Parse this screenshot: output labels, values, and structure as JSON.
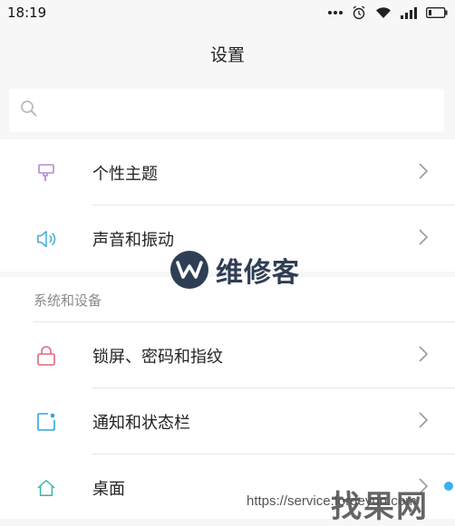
{
  "status_bar": {
    "time": "18:19",
    "icons": [
      "more-dots-icon",
      "alarm-icon",
      "wifi-icon",
      "signal-icon",
      "battery-icon"
    ]
  },
  "header": {
    "title": "设置"
  },
  "search": {
    "placeholder": "",
    "icon": "search-icon"
  },
  "group1": {
    "items": [
      {
        "label": "个性主题",
        "icon": "theme-brush-icon",
        "color": "#b589d6"
      },
      {
        "label": "声音和振动",
        "icon": "speaker-icon",
        "color": "#3fa9d8"
      }
    ]
  },
  "group2": {
    "section_title": "系统和设备",
    "items": [
      {
        "label": "锁屏、密码和指纹",
        "icon": "lock-icon",
        "color": "#e0697a"
      },
      {
        "label": "通知和状态栏",
        "icon": "notification-icon",
        "color": "#2fa6d9"
      },
      {
        "label": "桌面",
        "icon": "home-icon",
        "color": "#37b6a8"
      }
    ]
  },
  "watermarks": {
    "brand_text": "维修客",
    "url": "https://service.fordeyun.com",
    "logo_text": "找果网"
  },
  "colors": {
    "background": "#f7f7f7",
    "card": "#ffffff",
    "chevron": "#9a9a9a"
  }
}
